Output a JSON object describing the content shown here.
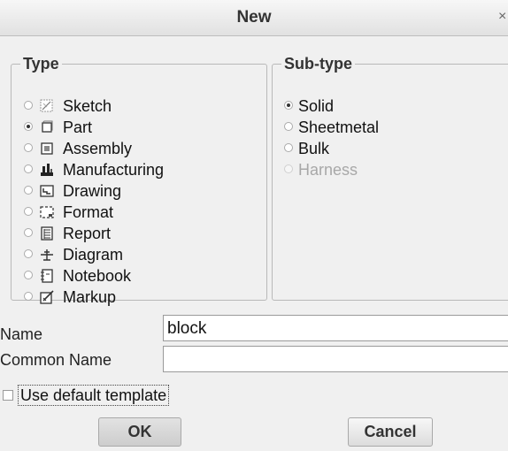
{
  "window": {
    "title": "New",
    "close_glyph": "×"
  },
  "type_group": {
    "legend": "Type",
    "items": [
      {
        "label": "Sketch",
        "icon": "sketch-icon",
        "selected": false
      },
      {
        "label": "Part",
        "icon": "part-icon",
        "selected": true
      },
      {
        "label": "Assembly",
        "icon": "assembly-icon",
        "selected": false
      },
      {
        "label": "Manufacturing",
        "icon": "manufacturing-icon",
        "selected": false
      },
      {
        "label": "Drawing",
        "icon": "drawing-icon",
        "selected": false
      },
      {
        "label": "Format",
        "icon": "format-icon",
        "selected": false
      },
      {
        "label": "Report",
        "icon": "report-icon",
        "selected": false
      },
      {
        "label": "Diagram",
        "icon": "diagram-icon",
        "selected": false
      },
      {
        "label": "Notebook",
        "icon": "notebook-icon",
        "selected": false
      },
      {
        "label": "Markup",
        "icon": "markup-icon",
        "selected": false
      }
    ]
  },
  "subtype_group": {
    "legend": "Sub-type",
    "items": [
      {
        "label": "Solid",
        "selected": true,
        "enabled": true
      },
      {
        "label": "Sheetmetal",
        "selected": false,
        "enabled": true
      },
      {
        "label": "Bulk",
        "selected": false,
        "enabled": true
      },
      {
        "label": "Harness",
        "selected": false,
        "enabled": false
      }
    ]
  },
  "fields": {
    "name_label": "Name",
    "name_value": "block",
    "common_name_label": "Common Name",
    "common_name_value": ""
  },
  "options": {
    "use_default_template_label": "Use default template",
    "use_default_template_checked": false
  },
  "buttons": {
    "ok": "OK",
    "cancel": "Cancel"
  }
}
